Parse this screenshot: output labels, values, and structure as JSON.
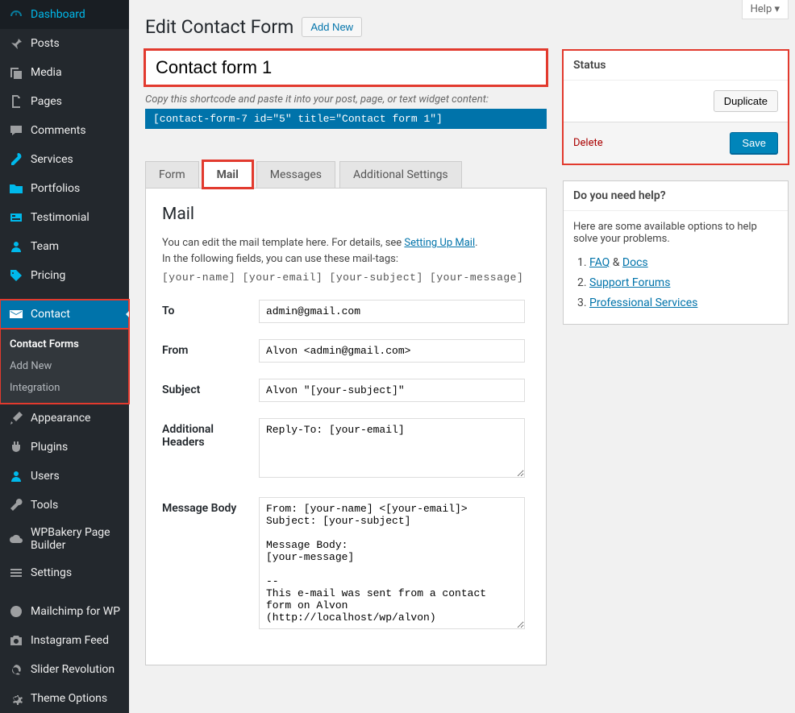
{
  "help_tab": "Help ▾",
  "header": {
    "title": "Edit Contact Form",
    "add_new": "Add New"
  },
  "form_title": "Contact form 1",
  "shortcode_hint": "Copy this shortcode and paste it into your post, page, or text widget content:",
  "shortcode": "[contact-form-7 id=\"5\" title=\"Contact form 1\"]",
  "sidebar": [
    {
      "label": "Dashboard",
      "icon": "dashboard"
    },
    {
      "label": "Posts",
      "icon": "pin"
    },
    {
      "label": "Media",
      "icon": "media"
    },
    {
      "label": "Pages",
      "icon": "pages"
    },
    {
      "label": "Comments",
      "icon": "comment"
    },
    {
      "label": "Services",
      "icon": "key"
    },
    {
      "label": "Portfolios",
      "icon": "folder"
    },
    {
      "label": "Testimonial",
      "icon": "card"
    },
    {
      "label": "Team",
      "icon": "user"
    },
    {
      "label": "Pricing",
      "icon": "tag"
    },
    {
      "label": "Contact",
      "icon": "mail"
    },
    {
      "label": "Appearance",
      "icon": "brush"
    },
    {
      "label": "Plugins",
      "icon": "plug"
    },
    {
      "label": "Users",
      "icon": "user"
    },
    {
      "label": "Tools",
      "icon": "wrench"
    },
    {
      "label": "WPBakery Page Builder",
      "icon": "cloud"
    },
    {
      "label": "Settings",
      "icon": "sliders"
    },
    {
      "label": "Mailchimp for WP",
      "icon": "circle"
    },
    {
      "label": "Instagram Feed",
      "icon": "camera"
    },
    {
      "label": "Slider Revolution",
      "icon": "refresh"
    },
    {
      "label": "Theme Options",
      "icon": "gear"
    }
  ],
  "submenu": [
    {
      "label": "Contact Forms",
      "current": true
    },
    {
      "label": "Add New",
      "current": false
    },
    {
      "label": "Integration",
      "current": false
    }
  ],
  "tabs": [
    {
      "label": "Form",
      "active": false
    },
    {
      "label": "Mail",
      "active": true
    },
    {
      "label": "Messages",
      "active": false
    },
    {
      "label": "Additional Settings",
      "active": false
    }
  ],
  "mail": {
    "heading": "Mail",
    "desc_pre": "You can edit the mail template here. For details, see ",
    "desc_link": "Setting Up Mail",
    "desc_post": ".",
    "desc2": "In the following fields, you can use these mail-tags:",
    "tags": "[your-name] [your-email] [your-subject] [your-message]",
    "labels": {
      "to": "To",
      "from": "From",
      "subject": "Subject",
      "addh": "Additional Headers",
      "body": "Message Body"
    },
    "to": "admin@gmail.com",
    "from": "Alvon <admin@gmail.com>",
    "subject": "Alvon \"[your-subject]\"",
    "additional_headers": "Reply-To: [your-email]",
    "message_body": "From: [your-name] <[your-email]>\nSubject: [your-subject]\n\nMessage Body:\n[your-message]\n\n--\nThis e-mail was sent from a contact form on Alvon (http://localhost/wp/alvon)"
  },
  "status_box": {
    "title": "Status",
    "duplicate": "Duplicate",
    "delete": "Delete",
    "save": "Save"
  },
  "help_box": {
    "title": "Do you need help?",
    "desc": "Here are some available options to help solve your problems.",
    "links": [
      {
        "pre": "",
        "a": "FAQ",
        "post": " & ",
        "a2": "Docs"
      },
      {
        "a": "Support Forums"
      },
      {
        "a": "Professional Services"
      }
    ]
  }
}
